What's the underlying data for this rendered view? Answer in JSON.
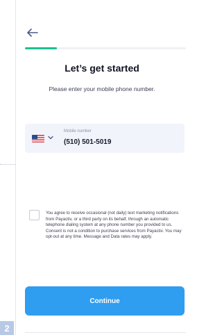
{
  "header": {
    "back_icon": "arrow-left-icon",
    "progress_fraction": 0.2,
    "progress_color": "#1fbf8f"
  },
  "page": {
    "title": "Let’s get started",
    "subtitle": "Please enter your mobile phone number."
  },
  "phone": {
    "country_flag_icon": "us-flag-icon",
    "dropdown_icon": "chevron-down-icon",
    "label": "Mobile number",
    "value": "(510) 501-5019"
  },
  "consent": {
    "checked": false,
    "text": "You agree to receive occasional (not daily) text marketing notifications from Payactiv, or a third party on its behalf, through an automatic telephone dialing system at any phone number you provided to us. Consent is not a condition to purchase services from Payactiv. You may opt-out at any time. Message and Data rates may apply."
  },
  "actions": {
    "continue_label": "Continue",
    "continue_color": "#2f9df0"
  },
  "step_badge": "2"
}
